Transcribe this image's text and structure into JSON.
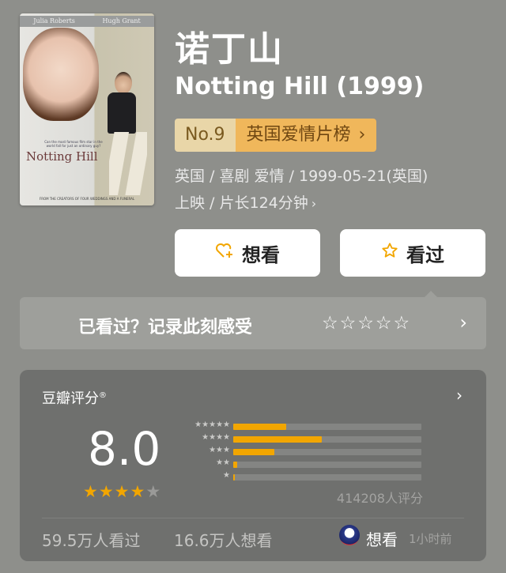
{
  "poster": {
    "actors": [
      "Julia Roberts",
      "Hugh Grant"
    ],
    "title": "Notting Hill",
    "tagline": "Can the most famous film star in the world fall for just an ordinary guy?",
    "footer": "FROM THE CREATORS OF FOUR WEDDINGS AND A FUNERAL"
  },
  "movie": {
    "title_cn": "诺丁山",
    "title_en": "Notting Hill (1999)",
    "rank_no": "No.9",
    "rank_list": "英国爱情片榜",
    "rank_chevron": "›",
    "meta_line1": "英国 / 喜剧 爱情 / 1999-05-21(英国)",
    "meta_line2": "上映 / 片长124分钟",
    "meta_chevron": "›"
  },
  "actions": {
    "want_icon": "heart-plus-icon",
    "want_label": "想看",
    "seen_icon": "star-outline-icon",
    "seen_label": "看过"
  },
  "record": {
    "text": "已看过？记录此刻感受",
    "stars": "☆☆☆☆☆",
    "chevron": "›"
  },
  "rating": {
    "label": "豆瓣评分",
    "registered_mark": "®",
    "chevron": "›",
    "score": "8.0",
    "stars_on": 4,
    "stars_total": 5,
    "distribution": [
      {
        "stars": "★★★★★",
        "fraction": 0.28
      },
      {
        "stars": "★★★★",
        "fraction": 0.47
      },
      {
        "stars": "★★★",
        "fraction": 0.22
      },
      {
        "stars": "★★",
        "fraction": 0.02
      },
      {
        "stars": "★",
        "fraction": 0.005
      }
    ],
    "count": "414208人评分",
    "seen_count": "59.5万人看过",
    "want_count": "16.6万人想看",
    "user_action": "想看",
    "user_time": "1小时前"
  },
  "colors": {
    "background": "#8e8f8b",
    "accent": "#f2a600",
    "rank_badge": "#f0b75b"
  }
}
